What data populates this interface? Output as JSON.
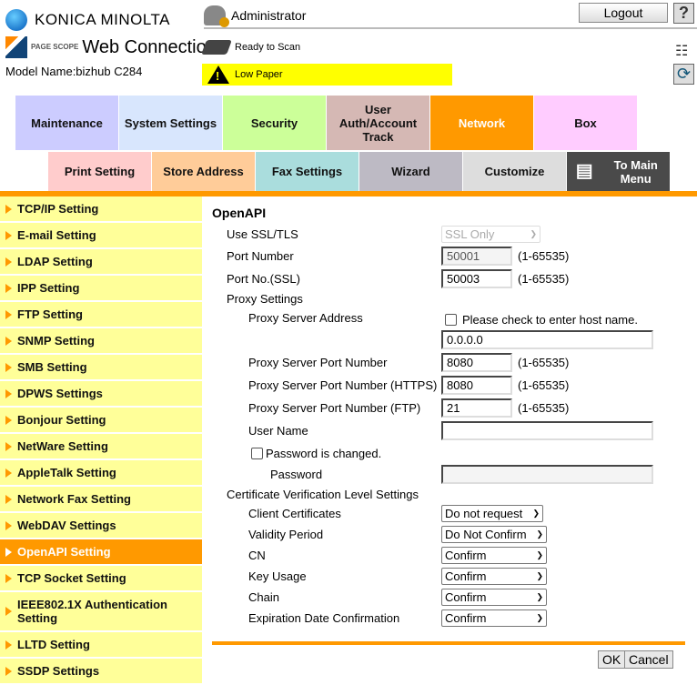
{
  "header": {
    "brand": "KONICA MINOLTA",
    "pagescope": "PAGE SCOPE",
    "product": "Web Connection",
    "model": "Model Name:bizhub C284",
    "user": "Administrator",
    "logout": "Logout",
    "help": "?",
    "status_scan": "Ready to Scan",
    "status_paper": "Low Paper",
    "status_paper_color": "#ffff00"
  },
  "tabs_row1": [
    {
      "label": "Maintenance",
      "color": "#ccccff"
    },
    {
      "label": "System Settings",
      "color": "#d8e6fd"
    },
    {
      "label": "Security",
      "color": "#ccff99"
    },
    {
      "label": "User Auth/Account Track",
      "color": "#d5b8b4"
    },
    {
      "label": "Network",
      "color": "#ff9900",
      "active": true
    },
    {
      "label": "Box",
      "color": "#ffccff"
    }
  ],
  "tabs_row2": [
    {
      "label": "Print Setting",
      "color": "#ffcccc"
    },
    {
      "label": "Store Address",
      "color": "#ffcc99"
    },
    {
      "label": "Fax Settings",
      "color": "#aadddd"
    },
    {
      "label": "Wizard",
      "color": "#bdbac4"
    },
    {
      "label": "Customize",
      "color": "#dddddd"
    },
    {
      "label": "To Main Menu",
      "color": "#4a4a4a"
    }
  ],
  "sidebar": {
    "items": [
      "TCP/IP Setting",
      "E-mail Setting",
      "LDAP Setting",
      "IPP Setting",
      "FTP Setting",
      "SNMP Setting",
      "SMB Setting",
      "DPWS Settings",
      "Bonjour Setting",
      "NetWare Setting",
      "AppleTalk Setting",
      "Network Fax Setting",
      "WebDAV Settings",
      "OpenAPI Setting",
      "TCP Socket Setting",
      "IEEE802.1X Authentication Setting",
      "LLTD Setting",
      "SSDP Settings"
    ],
    "active": "OpenAPI Setting"
  },
  "form": {
    "title": "OpenAPI",
    "use_ssl_label": "Use SSL/TLS",
    "use_ssl_value": "SSL Only",
    "port_label": "Port Number",
    "port_value": "50001",
    "range": "(1-65535)",
    "port_ssl_label": "Port No.(SSL)",
    "port_ssl_value": "50003",
    "proxy_label": "Proxy Settings",
    "proxy_addr_label": "Proxy Server Address",
    "proxy_host_check": "Please check to enter host name.",
    "proxy_addr_value": "0.0.0.0",
    "proxy_port_label": "Proxy Server Port Number",
    "proxy_port_value": "8080",
    "proxy_https_label": "Proxy Server Port Number (HTTPS)",
    "proxy_https_value": "8080",
    "proxy_ftp_label": "Proxy Server Port Number (FTP)",
    "proxy_ftp_value": "21",
    "username_label": "User Name",
    "username_value": "",
    "pw_changed_label": "Password is changed.",
    "password_label": "Password",
    "cert_label": "Certificate Verification Level Settings",
    "client_cert_label": "Client Certificates",
    "client_cert_value": "Do not request",
    "validity_label": "Validity Period",
    "validity_value": "Do Not Confirm",
    "cn_label": "CN",
    "cn_value": "Confirm",
    "key_usage_label": "Key Usage",
    "key_usage_value": "Confirm",
    "chain_label": "Chain",
    "chain_value": "Confirm",
    "expiration_label": "Expiration Date Confirmation",
    "expiration_value": "Confirm",
    "ok": "OK",
    "cancel": "Cancel"
  }
}
